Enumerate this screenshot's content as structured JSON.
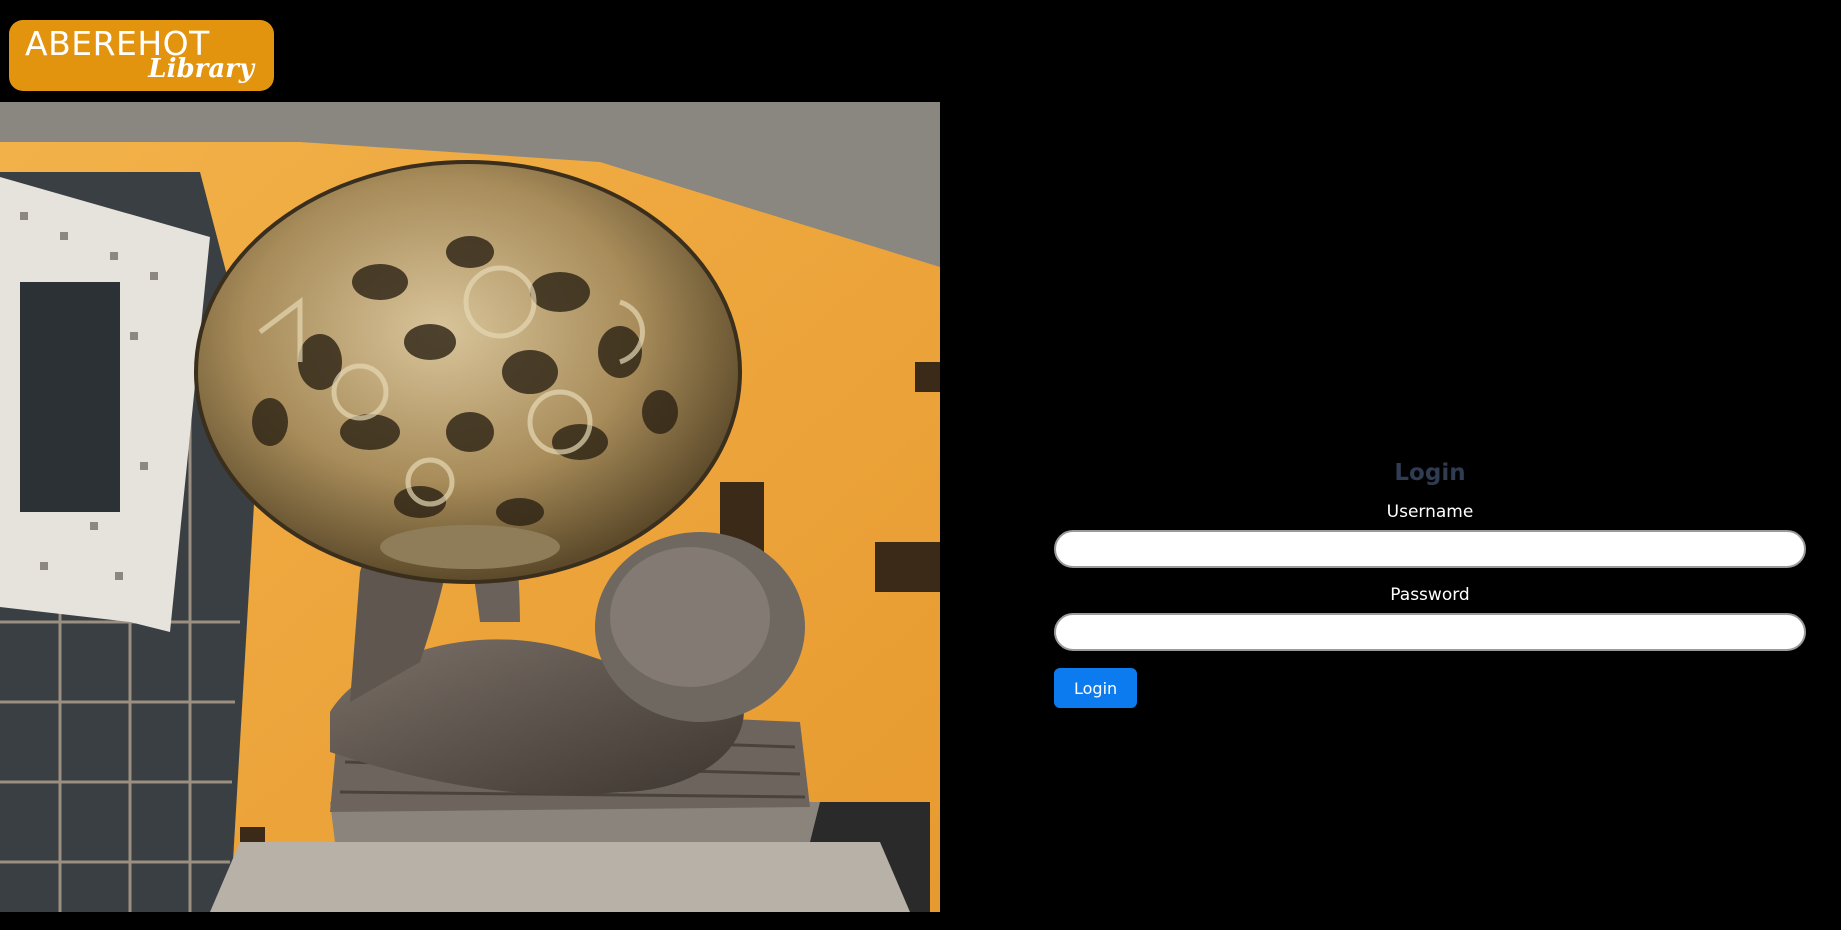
{
  "brand": {
    "name": "ABEREHOT",
    "subtitle": "Library",
    "color": "#e2940f"
  },
  "hero": {
    "image": "library-statue-photo"
  },
  "login": {
    "title": "Login",
    "username_label": "Username",
    "username_value": "",
    "password_label": "Password",
    "password_value": "",
    "submit_label": "Login",
    "button_color": "#0d7bf0"
  }
}
